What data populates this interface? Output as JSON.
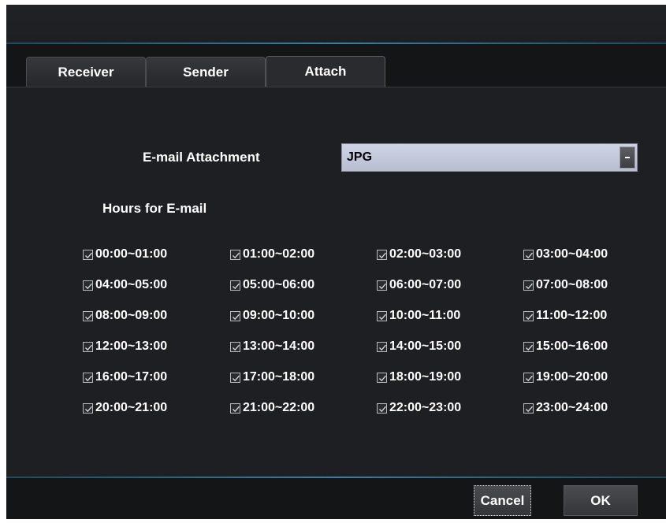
{
  "tabs": [
    {
      "label": "Receiver",
      "active": false
    },
    {
      "label": "Sender",
      "active": false
    },
    {
      "label": "Attach",
      "active": true
    }
  ],
  "attachment": {
    "label": "E-mail Attachment",
    "selected": "JPG"
  },
  "hours": {
    "label": "Hours for E-mail",
    "items": [
      {
        "label": "00:00~01:00",
        "checked": true
      },
      {
        "label": "01:00~02:00",
        "checked": true
      },
      {
        "label": "02:00~03:00",
        "checked": true
      },
      {
        "label": "03:00~04:00",
        "checked": true
      },
      {
        "label": "04:00~05:00",
        "checked": true
      },
      {
        "label": "05:00~06:00",
        "checked": true
      },
      {
        "label": "06:00~07:00",
        "checked": true
      },
      {
        "label": "07:00~08:00",
        "checked": true
      },
      {
        "label": "08:00~09:00",
        "checked": true
      },
      {
        "label": "09:00~10:00",
        "checked": true
      },
      {
        "label": "10:00~11:00",
        "checked": true
      },
      {
        "label": "11:00~12:00",
        "checked": true
      },
      {
        "label": "12:00~13:00",
        "checked": true
      },
      {
        "label": "13:00~14:00",
        "checked": true
      },
      {
        "label": "14:00~15:00",
        "checked": true
      },
      {
        "label": "15:00~16:00",
        "checked": true
      },
      {
        "label": "16:00~17:00",
        "checked": true
      },
      {
        "label": "17:00~18:00",
        "checked": true
      },
      {
        "label": "18:00~19:00",
        "checked": true
      },
      {
        "label": "19:00~20:00",
        "checked": true
      },
      {
        "label": "20:00~21:00",
        "checked": true
      },
      {
        "label": "21:00~22:00",
        "checked": true
      },
      {
        "label": "22:00~23:00",
        "checked": true
      },
      {
        "label": "23:00~24:00",
        "checked": true
      }
    ]
  },
  "buttons": {
    "cancel": "Cancel",
    "ok": "OK"
  },
  "icons": {
    "dropdown": "dropdown-arrow-icon",
    "checkbox": "checkmark-icon"
  }
}
